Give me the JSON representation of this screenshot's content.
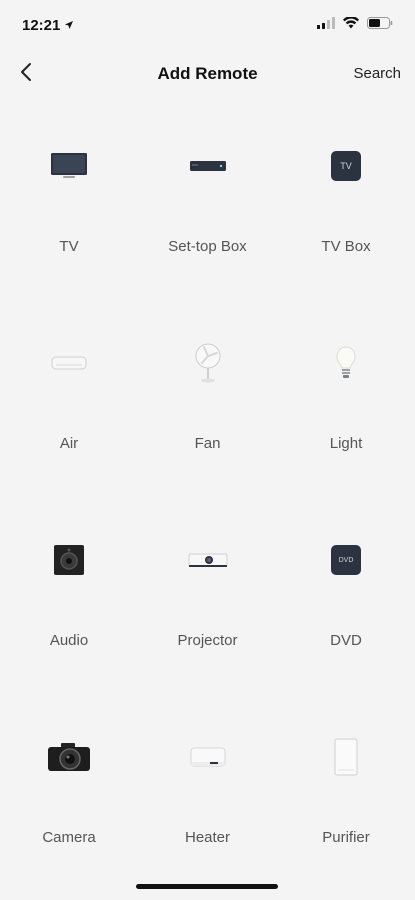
{
  "status_bar": {
    "time": "12:21",
    "icons": [
      "location-arrow-icon",
      "cellular-signal-icon",
      "wifi-icon",
      "battery-icon"
    ]
  },
  "nav": {
    "back_icon": "chevron-left-icon",
    "title": "Add Remote",
    "search_label": "Search"
  },
  "devices": [
    {
      "label": "TV",
      "icon": "tv-icon"
    },
    {
      "label": "Set-top Box",
      "icon": "set-top-box-icon"
    },
    {
      "label": "TV Box",
      "icon": "tv-box-icon",
      "icon_text": "TV"
    },
    {
      "label": "Air",
      "icon": "air-conditioner-icon"
    },
    {
      "label": "Fan",
      "icon": "fan-icon"
    },
    {
      "label": "Light",
      "icon": "light-bulb-icon"
    },
    {
      "label": "Audio",
      "icon": "speaker-icon"
    },
    {
      "label": "Projector",
      "icon": "projector-icon"
    },
    {
      "label": "DVD",
      "icon": "dvd-player-icon",
      "icon_text": "DVD"
    },
    {
      "label": "Camera",
      "icon": "camera-icon"
    },
    {
      "label": "Heater",
      "icon": "heater-icon"
    },
    {
      "label": "Purifier",
      "icon": "purifier-icon"
    }
  ],
  "colors": {
    "background": "#f4f4f4",
    "text_primary": "#111111",
    "text_label": "#555555",
    "device_dark": "#2b3340"
  }
}
